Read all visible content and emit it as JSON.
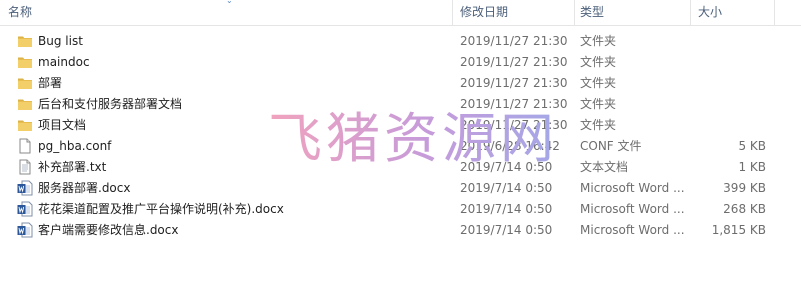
{
  "columns": {
    "name": "名称",
    "modified": "修改日期",
    "type": "类型",
    "size": "大小"
  },
  "files": [
    {
      "name": "Bug list",
      "modified": "2019/11/27 21:30",
      "type": "文件夹",
      "size": "",
      "icon": "folder-icon"
    },
    {
      "name": "maindoc",
      "modified": "2019/11/27 21:30",
      "type": "文件夹",
      "size": "",
      "icon": "folder-icon"
    },
    {
      "name": "部署",
      "modified": "2019/11/27 21:30",
      "type": "文件夹",
      "size": "",
      "icon": "folder-icon"
    },
    {
      "name": "后台和支付服务器部署文档",
      "modified": "2019/11/27 21:30",
      "type": "文件夹",
      "size": "",
      "icon": "folder-icon"
    },
    {
      "name": "项目文档",
      "modified": "2019/11/27 21:30",
      "type": "文件夹",
      "size": "",
      "icon": "folder-icon"
    },
    {
      "name": "pg_hba.conf",
      "modified": "2019/6/28 16:42",
      "type": "CONF 文件",
      "size": "5 KB",
      "icon": "file-icon"
    },
    {
      "name": "补充部署.txt",
      "modified": "2019/7/14 0:50",
      "type": "文本文档",
      "size": "1 KB",
      "icon": "text-file-icon"
    },
    {
      "name": "服务器部署.docx",
      "modified": "2019/7/14 0:50",
      "type": "Microsoft Word ...",
      "size": "399 KB",
      "icon": "word-document-icon"
    },
    {
      "name": "花花渠道配置及推广平台操作说明(补充).docx",
      "modified": "2019/7/14 0:50",
      "type": "Microsoft Word ...",
      "size": "268 KB",
      "icon": "word-document-icon"
    },
    {
      "name": "客户端需要修改信息.docx",
      "modified": "2019/7/14 0:50",
      "type": "Microsoft Word ...",
      "size": "1,815 KB",
      "icon": "word-document-icon"
    }
  ],
  "watermark": "飞猪资源网"
}
